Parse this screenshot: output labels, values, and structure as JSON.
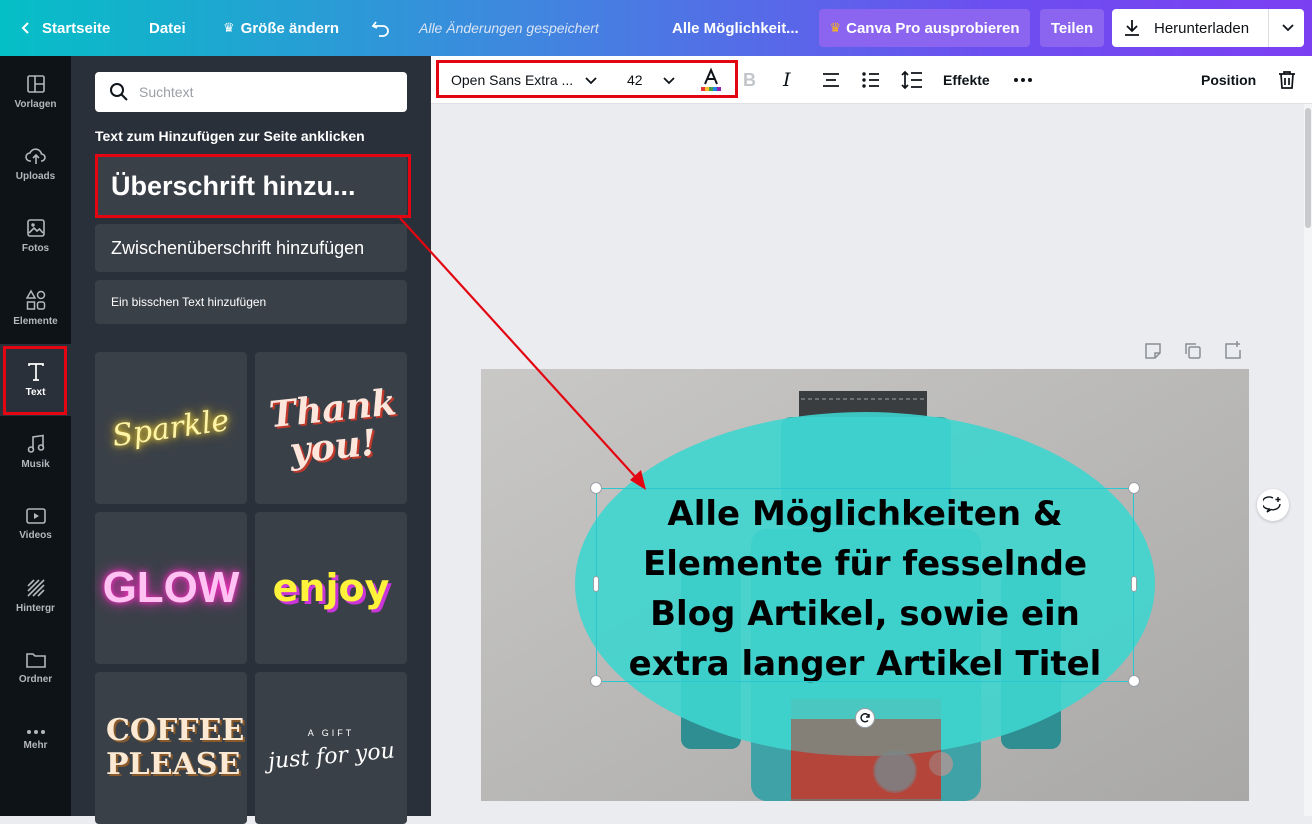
{
  "topbar": {
    "home_label": "Startseite",
    "file_label": "Datei",
    "resize_label": "Größe ändern",
    "saved_status": "Alle Änderungen gespeichert",
    "doc_title": "Alle Möglichkeit...",
    "pro_label": "Canva Pro ausprobieren",
    "share_label": "Teilen",
    "download_label": "Herunterladen"
  },
  "sidebar": {
    "items": [
      {
        "label": "Vorlagen",
        "icon": "layout-icon"
      },
      {
        "label": "Uploads",
        "icon": "upload-cloud-icon"
      },
      {
        "label": "Fotos",
        "icon": "image-icon"
      },
      {
        "label": "Elemente",
        "icon": "shapes-icon"
      },
      {
        "label": "Text",
        "icon": "text-icon"
      },
      {
        "label": "Musik",
        "icon": "music-icon"
      },
      {
        "label": "Videos",
        "icon": "video-icon"
      },
      {
        "label": "Hintergr",
        "icon": "background-icon"
      },
      {
        "label": "Ordner",
        "icon": "folder-icon"
      },
      {
        "label": "Mehr",
        "icon": "more-icon"
      }
    ]
  },
  "panel": {
    "search_placeholder": "Suchtext",
    "heading": "Text zum Hinzufügen zur Seite anklicken",
    "heading_btn": "Überschrift hinzu...",
    "subheading_btn": "Zwischenüberschrift hinzufügen",
    "body_btn": "Ein bisschen Text hinzufügen",
    "tiles": [
      "Sparkle",
      "Thank you!",
      "GLOW",
      "enjoy",
      "COFFEE PLEASE",
      "A GIFT",
      "just for you"
    ]
  },
  "toolbar": {
    "font_name": "Open Sans Extra ...",
    "font_size": "42",
    "effects_label": "Effekte",
    "position_label": "Position"
  },
  "canvas": {
    "headline": "Alle Möglichkeiten & Elemente für fesselnde Blog Artikel, sowie ein extra langer Artikel Titel"
  },
  "colors": {
    "accent_red": "#e40512",
    "ellipse": "#3ed5cf",
    "pro_crown": "#f7b21b"
  }
}
